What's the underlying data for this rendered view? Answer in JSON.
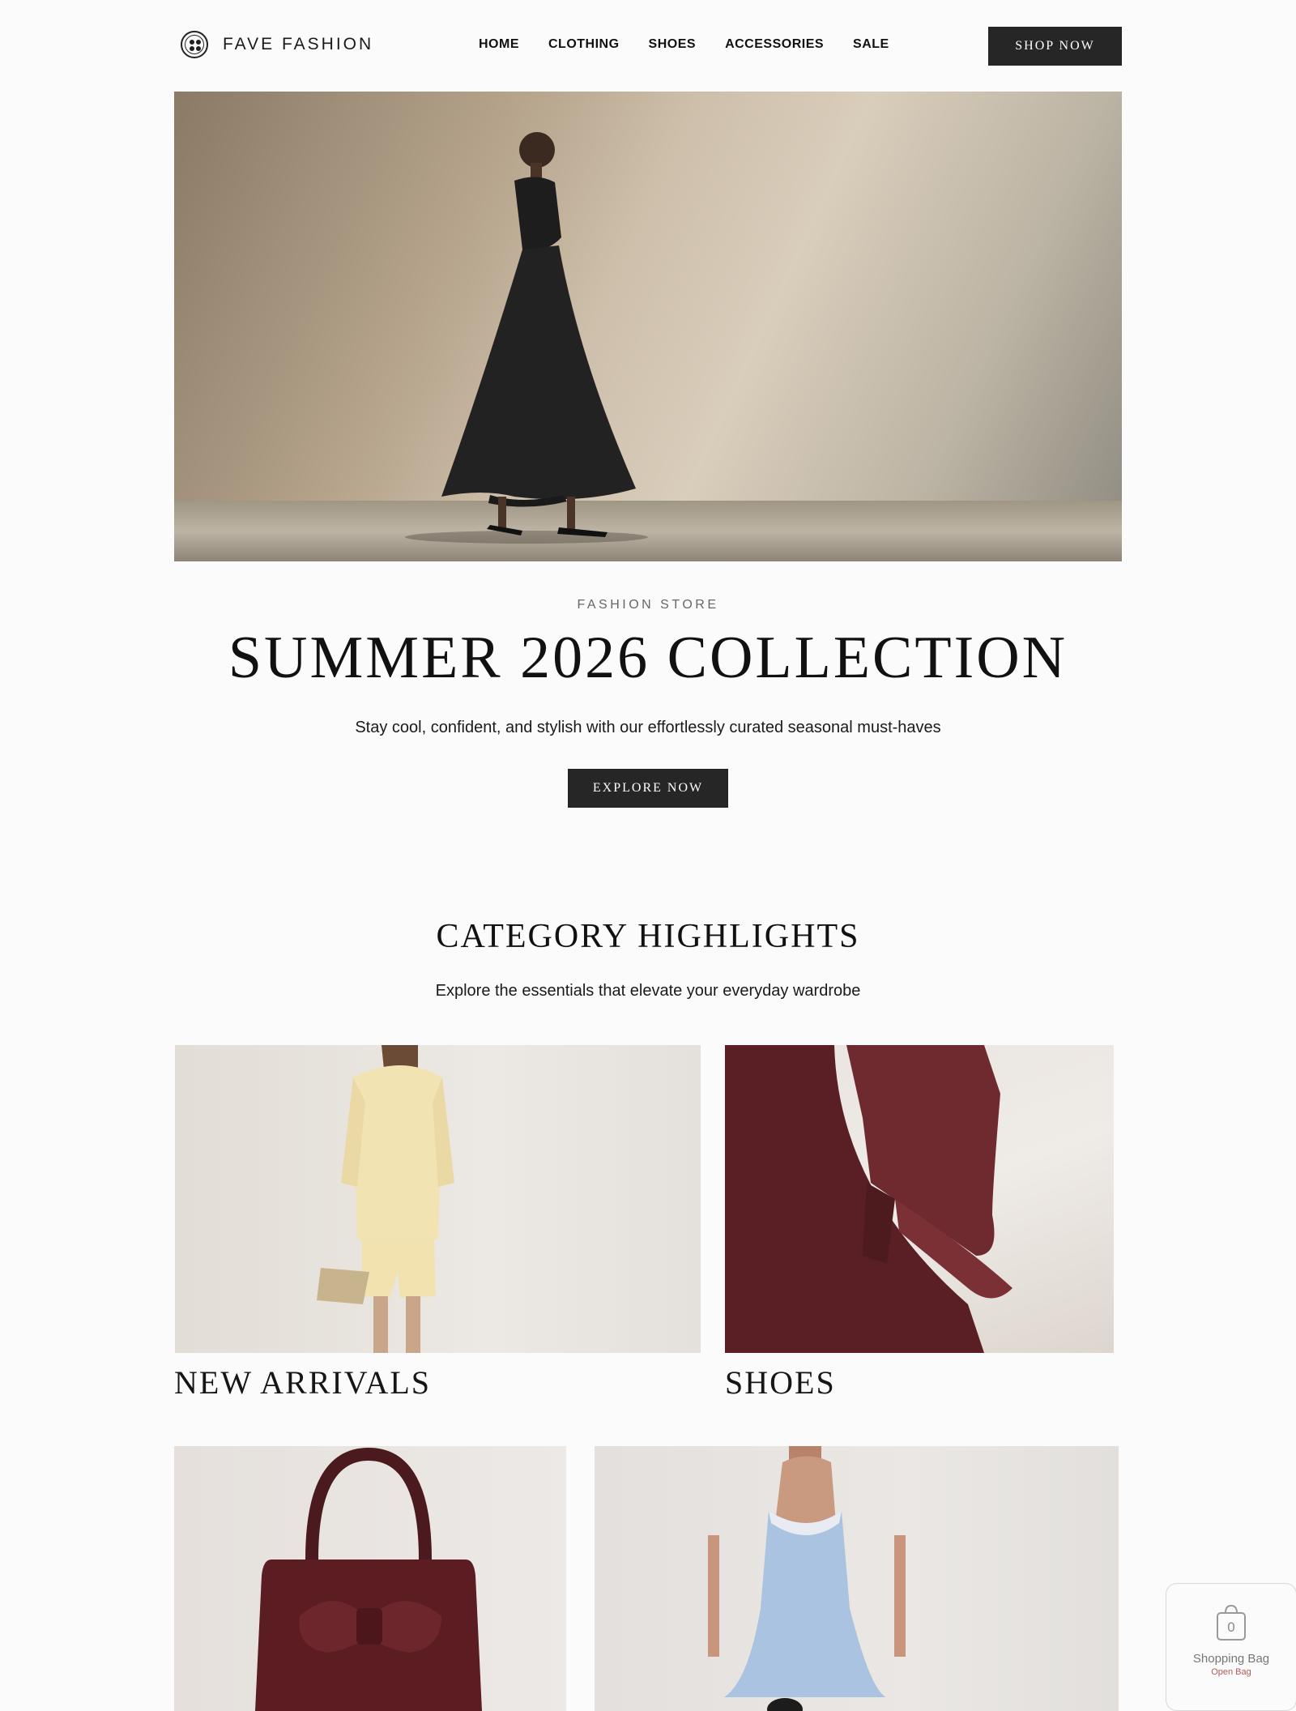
{
  "brand": {
    "name": "FAVE FASHION",
    "logo_icon": "button-logo-icon"
  },
  "nav": {
    "items": [
      {
        "label": "HOME"
      },
      {
        "label": "CLOTHING"
      },
      {
        "label": "SHOES"
      },
      {
        "label": "ACCESSORIES"
      },
      {
        "label": "SALE"
      }
    ],
    "cta": "SHOP NOW"
  },
  "hero": {
    "eyebrow": "FASHION STORE",
    "title": "SUMMER 2026 COLLECTION",
    "subtitle": "Stay cool, confident, and stylish with our effortlessly curated seasonal must-haves",
    "button": "EXPLORE NOW"
  },
  "categories": {
    "title": "CATEGORY HIGHLIGHTS",
    "subtitle": "Explore the essentials that elevate your everyday wardrobe",
    "items": [
      {
        "label": "NEW ARRIVALS"
      },
      {
        "label": "SHOES"
      },
      {
        "label": ""
      },
      {
        "label": ""
      }
    ]
  },
  "bag": {
    "count": "0",
    "title": "Shopping Bag",
    "link": "Open Bag",
    "icon": "shopping-bag-icon"
  },
  "colors": {
    "dark_button": "#262626",
    "page_bg": "#fbfbfb",
    "accent_link": "#b25a5a"
  }
}
